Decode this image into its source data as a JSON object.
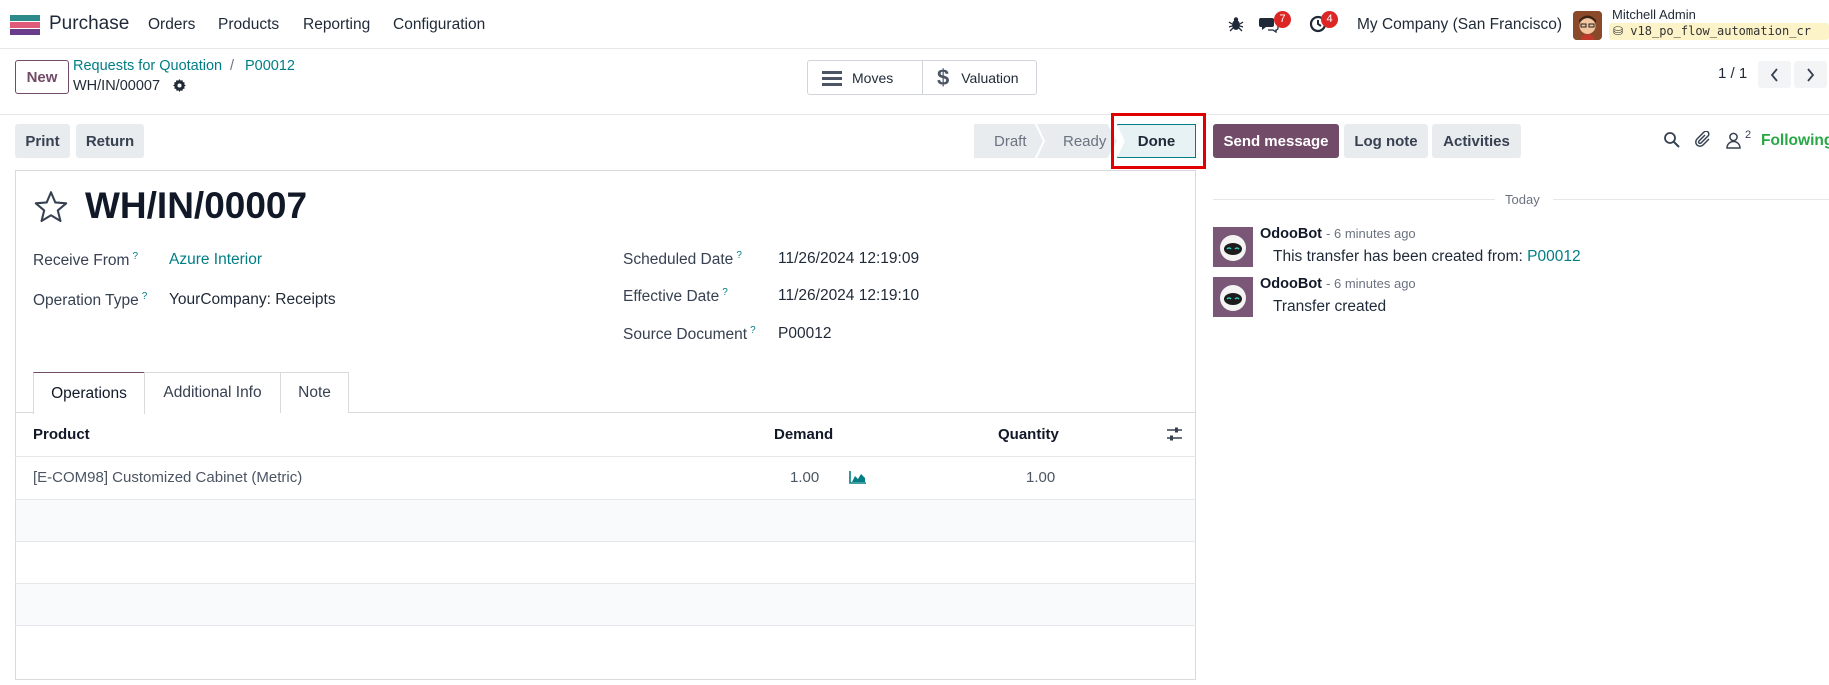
{
  "navbar": {
    "app_name": "Purchase",
    "menu": [
      "Orders",
      "Products",
      "Reporting",
      "Configuration"
    ],
    "messages_badge": "7",
    "activities_badge": "4",
    "company": "My Company (San Francisco)",
    "user_name": "Mitchell Admin",
    "database": "v18_po_flow_automation_cr"
  },
  "control_panel": {
    "new_label": "New",
    "breadcrumb": [
      "Requests for Quotation",
      "P00012"
    ],
    "breadcrumb_sep": "/",
    "current": "WH/IN/00007",
    "smart_buttons": {
      "moves": "Moves",
      "valuation": "Valuation"
    },
    "pager": "1 / 1"
  },
  "form_header": {
    "print_label": "Print",
    "return_label": "Return",
    "stages": [
      "Draft",
      "Ready",
      "Done"
    ],
    "active_stage": "Done"
  },
  "record": {
    "title": "WH/IN/00007",
    "fields": {
      "receive_from": {
        "label": "Receive From",
        "value": "Azure Interior"
      },
      "operation_type": {
        "label": "Operation Type",
        "value": "YourCompany: Receipts"
      },
      "scheduled_date": {
        "label": "Scheduled Date",
        "value": "11/26/2024 12:19:09"
      },
      "effective_date": {
        "label": "Effective Date",
        "value": "11/26/2024 12:19:10"
      },
      "source_document": {
        "label": "Source Document",
        "value": "P00012"
      }
    },
    "help_mark": "?",
    "tabs": [
      "Operations",
      "Additional Info",
      "Note"
    ],
    "active_tab": "Operations",
    "table": {
      "headers": [
        "Product",
        "Demand",
        "Quantity"
      ],
      "rows": [
        {
          "product": "[E-COM98] Customized Cabinet (Metric)",
          "demand": "1.00",
          "quantity": "1.00"
        }
      ]
    }
  },
  "chatter": {
    "send_message": "Send message",
    "log_note": "Log note",
    "activities": "Activities",
    "followers_count": "2",
    "following": "Following",
    "date_separator": "Today",
    "messages": [
      {
        "author": "OdooBot",
        "time": "- 6 minutes ago",
        "text": "This transfer has been created from:",
        "link": "P00012"
      },
      {
        "author": "OdooBot",
        "time": "- 6 minutes ago",
        "text": "Transfer created"
      }
    ]
  },
  "colors": {
    "brand": "#714b67",
    "link": "#017e84",
    "highlight_box": "#e00000",
    "badge": "#dc2626",
    "following": "#28a745"
  }
}
